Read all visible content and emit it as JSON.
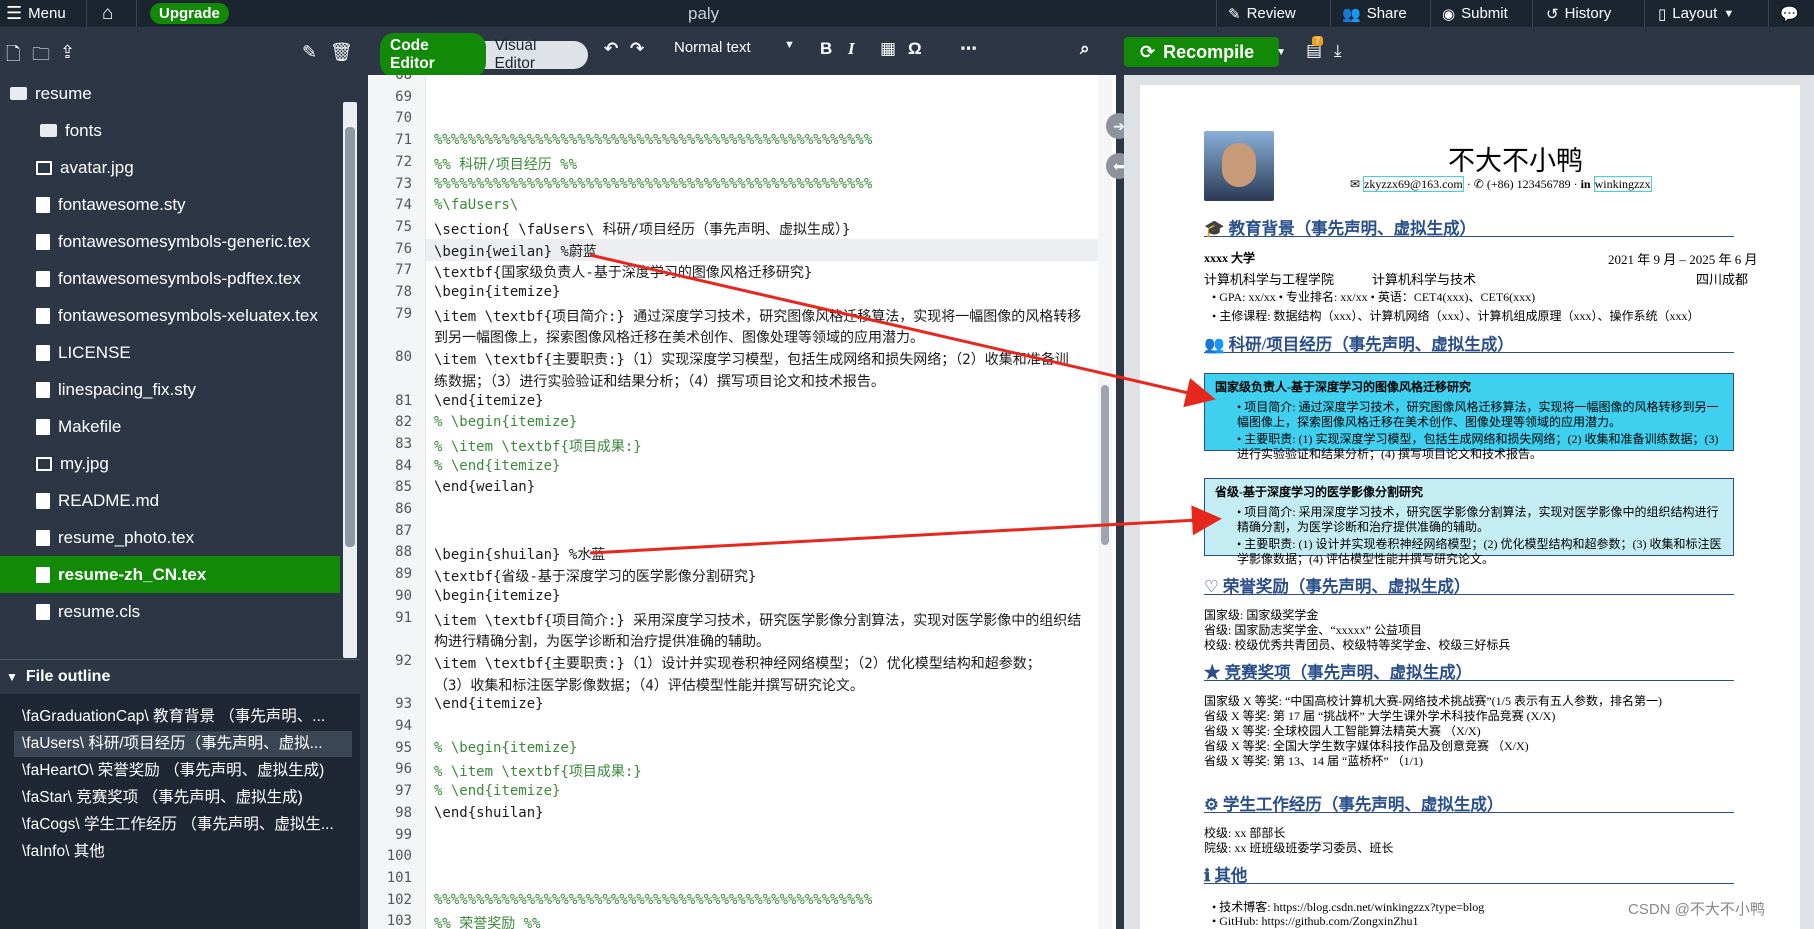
{
  "topbar": {
    "menu": "Menu",
    "upgrade": "Upgrade",
    "title": "paly",
    "review": "Review",
    "share": "Share",
    "submit": "Submit",
    "history": "History",
    "layout": "Layout"
  },
  "tree": [
    {
      "label": "resume",
      "kind": "folder"
    },
    {
      "label": "fonts",
      "kind": "folder"
    },
    {
      "label": "avatar.jpg",
      "kind": "img"
    },
    {
      "label": "fontawesome.sty",
      "kind": "file"
    },
    {
      "label": "fontawesomesymbols-generic.tex",
      "kind": "file"
    },
    {
      "label": "fontawesomesymbols-pdftex.tex",
      "kind": "file"
    },
    {
      "label": "fontawesomesymbols-xeluatex.tex",
      "kind": "file"
    },
    {
      "label": "LICENSE",
      "kind": "file"
    },
    {
      "label": "linespacing_fix.sty",
      "kind": "file"
    },
    {
      "label": "Makefile",
      "kind": "file"
    },
    {
      "label": "my.jpg",
      "kind": "img"
    },
    {
      "label": "README.md",
      "kind": "file"
    },
    {
      "label": "resume_photo.tex",
      "kind": "file"
    },
    {
      "label": "resume-zh_CN.tex",
      "kind": "file"
    },
    {
      "label": "resume.cls",
      "kind": "file"
    }
  ],
  "outline": {
    "header": "File outline",
    "items": [
      "\\faGraduationCap\\ 教育背景 （事先声明、...",
      "\\faUsers\\ 科研/项目经历（事先声明、虚拟...",
      "\\faHeartO\\ 荣誉奖励 （事先声明、虚拟生成)",
      "\\faStar\\ 竞赛奖项 （事先声明、虚拟生成)",
      "\\faCogs\\ 学生工作经历 （事先声明、虚拟生...",
      "\\faInfo\\ 其他"
    ]
  },
  "editor": {
    "code_editor": "Code Editor",
    "visual_editor": "Visual Editor",
    "style": "Normal text",
    "lines": [
      {
        "n": "68",
        "t": ""
      },
      {
        "n": "69",
        "t": ""
      },
      {
        "n": "70",
        "t": ""
      },
      {
        "n": "71",
        "t": "%%%%%%%%%%%%%%%%%%%%%%%%%%%%%%%%%%%%%%%%%%%%%%%%%%%%"
      },
      {
        "n": "72",
        "t": "%%               科研/项目经历                 %%"
      },
      {
        "n": "73",
        "t": "%%%%%%%%%%%%%%%%%%%%%%%%%%%%%%%%%%%%%%%%%%%%%%%%%%%%"
      },
      {
        "n": "74",
        "t": "%\\faUsers\\"
      },
      {
        "n": "75",
        "t": "\\section{ \\faUsers\\ 科研/项目经历（事先声明、虚拟生成）}"
      },
      {
        "n": "76",
        "t": "\\begin{weilan} %蔚蓝"
      },
      {
        "n": "77",
        "t": "\\textbf{国家级负责人-基于深度学习的图像风格迁移研究}"
      },
      {
        "n": "78",
        "t": "\\begin{itemize}"
      },
      {
        "n": "79",
        "t": "  \\item \\textbf{项目简介:} 通过深度学习技术，研究图像风格迁移算法，实现将一幅图像的风格转移"
      },
      {
        "n": "",
        "t": "  到另一幅图像上，探索图像风格迁移在美术创作、图像处理等领域的应用潜力。"
      },
      {
        "n": "80",
        "t": "  \\item \\textbf{主要职责:}（1）实现深度学习模型，包括生成网络和损失网络；（2）收集和准备训"
      },
      {
        "n": "",
        "t": "  练数据；（3）进行实验验证和结果分析；（4）撰写项目论文和技术报告。"
      },
      {
        "n": "81",
        "t": "\\end{itemize}"
      },
      {
        "n": "82",
        "t": "% \\begin{itemize}"
      },
      {
        "n": "83",
        "t": "%   \\item \\textbf{项目成果:}"
      },
      {
        "n": "84",
        "t": "% \\end{itemize}"
      },
      {
        "n": "85",
        "t": "\\end{weilan}"
      },
      {
        "n": "86",
        "t": ""
      },
      {
        "n": "87",
        "t": ""
      },
      {
        "n": "88",
        "t": "\\begin{shuilan} %水蓝"
      },
      {
        "n": "89",
        "t": "\\textbf{省级-基于深度学习的医学影像分割研究}"
      },
      {
        "n": "90",
        "t": "\\begin{itemize}"
      },
      {
        "n": "91",
        "t": "  \\item \\textbf{项目简介:} 采用深度学习技术，研究医学影像分割算法，实现对医学影像中的组织结"
      },
      {
        "n": "",
        "t": "  构进行精确分割，为医学诊断和治疗提供准确的辅助。"
      },
      {
        "n": "92",
        "t": "  \\item \\textbf{主要职责:}（1）设计并实现卷积神经网络模型；（2）优化模型结构和超参数；"
      },
      {
        "n": "",
        "t": "  （3）收集和标注医学影像数据；（4）评估模型性能并撰写研究论文。"
      },
      {
        "n": "93",
        "t": "\\end{itemize}"
      },
      {
        "n": "94",
        "t": ""
      },
      {
        "n": "95",
        "t": "% \\begin{itemize}"
      },
      {
        "n": "96",
        "t": "%   \\item \\textbf{项目成果:}"
      },
      {
        "n": "97",
        "t": "% \\end{itemize}"
      },
      {
        "n": "98",
        "t": "\\end{shuilan}"
      },
      {
        "n": "99",
        "t": ""
      },
      {
        "n": "100",
        "t": ""
      },
      {
        "n": "101",
        "t": ""
      },
      {
        "n": "102",
        "t": "%%%%%%%%%%%%%%%%%%%%%%%%%%%%%%%%%%%%%%%%%%%%%%%%%%%%"
      },
      {
        "n": "103",
        "t": "%%                  荣誉奖励                  %%"
      }
    ]
  },
  "pdf": {
    "recompile": "Recompile",
    "badge": "7",
    "name": "不大不小鸭",
    "email": "zkyzzx69@163.com",
    "phone": "(+86) 123456789",
    "linkedin": "winkingzzx",
    "sec1": "教育背景（事先声明、虚拟生成）",
    "school": "xxxx 大学",
    "date": "2021 年 9 月 – 2025 年 6 月",
    "college": "计算机科学与工程学院",
    "major": "计算机科学与技术",
    "city": "四川成都",
    "gpa": "• GPA: xx/xx     • 专业排名: xx/xx     • 英语：CET4(xxx)、CET6(xxx)",
    "courses": "• 主修课程: 数据结构（xxx）、计算机网络（xxx）、计算机组成原理（xxx）、操作系统（xxx）",
    "sec2": "科研/项目经历（事先声明、虚拟生成）",
    "p1t": "国家级负责人-基于深度学习的图像风格迁移研究",
    "p1a": "• 项目简介: 通过深度学习技术，研究图像风格迁移算法，实现将一幅图像的风格转移到另一幅图像上，探索图像风格迁移在美术创作、图像处理等领域的应用潜力。",
    "p1b": "• 主要职责: (1) 实现深度学习模型，包括生成网络和损失网络；(2) 收集和准备训练数据；(3) 进行实验验证和结果分析；(4) 撰写项目论文和技术报告。",
    "p2t": "省级-基于深度学习的医学影像分割研究",
    "p2a": "• 项目简介: 采用深度学习技术，研究医学影像分割算法，实现对医学影像中的组织结构进行精确分割，为医学诊断和治疗提供准确的辅助。",
    "p2b": "• 主要职责: (1) 设计并实现卷积神经网络模型；(2) 优化模型结构和超参数；(3) 收集和标注医学影像数据；(4) 评估模型性能并撰写研究论文。",
    "sec3": "荣誉奖励（事先声明、虚拟生成）",
    "h1": "国家级: 国家级奖学金",
    "h2": "省级: 国家励志奖学金、“xxxxx” 公益项目",
    "h3": "校级: 校级优秀共青团员、校级特等奖学金、校级三好标兵",
    "sec4": "竞赛奖项（事先声明、虚拟生成）",
    "c1": "国家级 X 等奖: “中国高校计算机大赛-网络技术挑战赛”(1/5 表示有五人参数，排名第一)",
    "c2": "省级 X 等奖: 第 17 届 “挑战杯” 大学生课外学术科技作品竞赛 (X/X)",
    "c3": "省级 X 等奖: 全球校园人工智能算法精英大赛 （X/X)",
    "c4": "省级 X 等奖: 全国大学生数字媒体科技作品及创意竞赛 （X/X)",
    "c5": "省级 X 等奖: 第 13、14 届 “蓝桥杯” （1/1)",
    "sec5": "学生工作经历（事先声明、虚拟生成）",
    "s1": "校级: xx 部部长",
    "s2": "院级: xx 班班级班委学习委员、班长",
    "sec6": "其他",
    "o1": "• 技术博客: https://blog.csdn.net/winkingzzx?type=blog",
    "o2": "• GitHub: https://github.com/ZongxinZhu1"
  },
  "watermark": "CSDN @不大不小鸭",
  "colors": {
    "green": "#138a07",
    "dark": "#1b2530",
    "panel": "#2c3645",
    "box1": "#3fd0ef",
    "box2": "#c3ecf3",
    "arrow": "#e8271c"
  }
}
